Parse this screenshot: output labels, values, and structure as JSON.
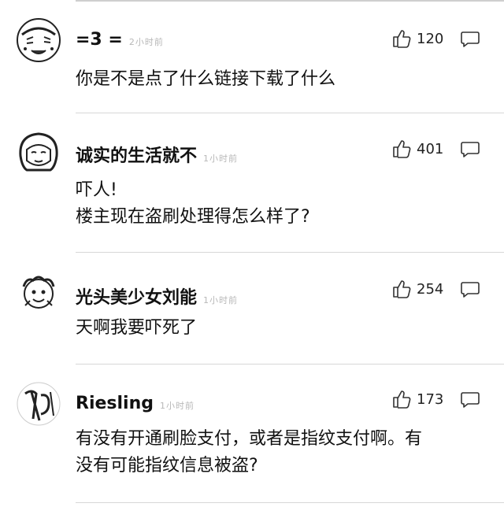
{
  "comments": [
    {
      "username": "=3 =",
      "time": "2小时前",
      "likes": "120",
      "lines": [
        "你是不是点了什么链接下载了什么"
      ]
    },
    {
      "username": "诚实的生活就不",
      "time": "1小时前",
      "likes": "401",
      "lines": [
        "吓人!",
        "楼主现在盗刷处理得怎么样了?"
      ]
    },
    {
      "username": "光头美少女刘能",
      "time": "1小时前",
      "likes": "254",
      "lines": [
        "天啊我要吓死了"
      ]
    },
    {
      "username": "Riesling",
      "time": "1小时前",
      "likes": "173",
      "lines": [
        "有没有开通刷脸支付，或者是指纹支付啊。有",
        "没有可能指纹信息被盗?"
      ]
    }
  ]
}
